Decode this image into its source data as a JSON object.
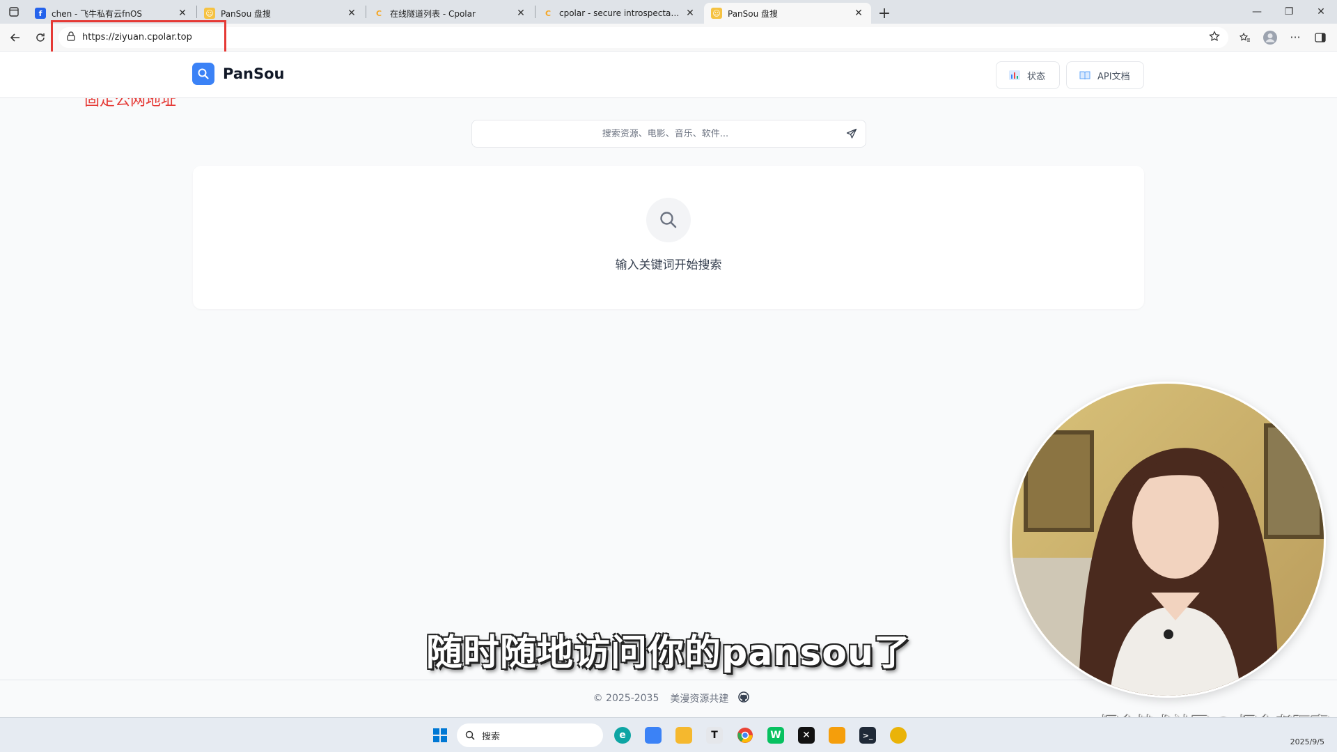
{
  "browser": {
    "tabs": [
      {
        "title": "chen - 飞牛私有云fnOS",
        "favicon_color": "#2563eb",
        "active": false
      },
      {
        "title": "PanSou 盘搜",
        "favicon_color": "#f5c242",
        "active": false
      },
      {
        "title": "在线隧道列表 - Cpolar",
        "favicon_color": "#f5a623",
        "active": false
      },
      {
        "title": "cpolar - secure introspectable tun",
        "favicon_color": "#f5a623",
        "active": false
      },
      {
        "title": "PanSou 盘搜",
        "favicon_color": "#f5c242",
        "active": true
      }
    ],
    "url": "https://ziyuan.cpolar.top"
  },
  "annotation": {
    "text": "固定公网地址",
    "color": "#e53935"
  },
  "app": {
    "brand": "PanSou",
    "brand_color": "#3b82f6",
    "header_buttons": {
      "status_label": "状态",
      "api_label": "API文档"
    },
    "search": {
      "placeholder": "搜索资源、电影、音乐、软件..."
    },
    "empty_state": {
      "text": "输入关键词开始搜索"
    },
    "footer": {
      "copyright": "© 2025-2035",
      "link": "美漫资源共建"
    }
  },
  "video_overlay": {
    "subtitle": "随时随地访问你的pansou了",
    "watermark": "掘金技术社区 @ 掘金者阿豪"
  },
  "taskbar": {
    "search_label": "搜索",
    "date": "2025/9/5"
  }
}
